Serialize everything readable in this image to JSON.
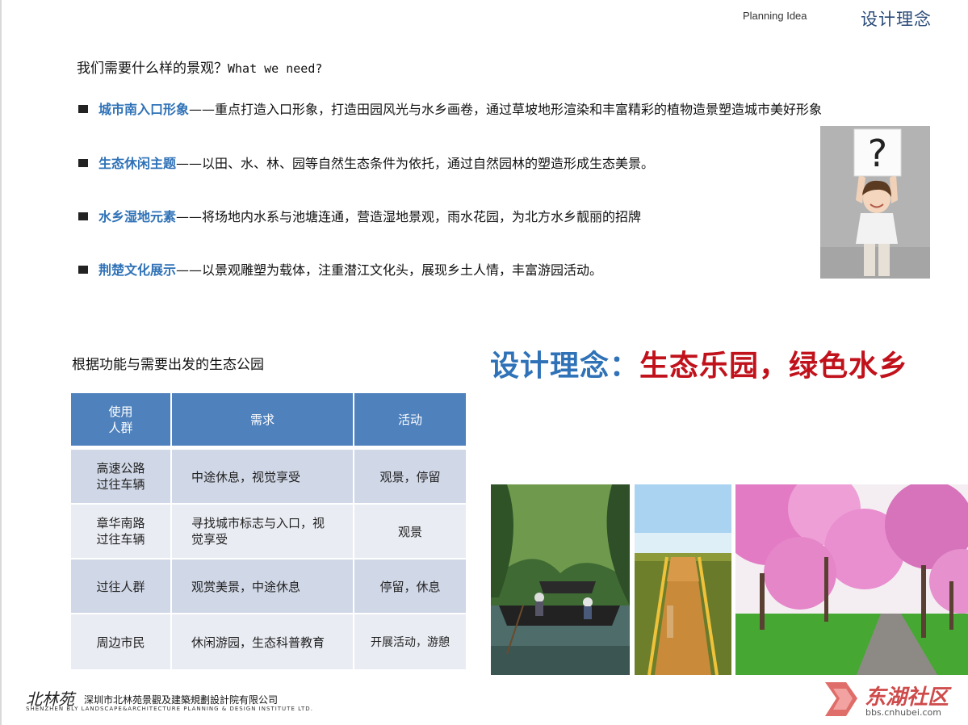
{
  "header": {
    "planning_idea": "Planning Idea",
    "title": "设计理念"
  },
  "question": {
    "cn": "我们需要什么样的景观？",
    "en": "What we need?"
  },
  "bullets": [
    {
      "keyword": "城市南入口形象",
      "text": "——重点打造入口形象，打造田园风光与水乡画卷，通过草坡地形渲染和丰富精彩的植物造景塑造城市美好形象"
    },
    {
      "keyword": "生态休闲主题",
      "text": "——以田、水、林、园等自然生态条件为依托，通过自然园林的塑造形成生态美景。"
    },
    {
      "keyword": "水乡湿地元素",
      "text": "——将场地内水系与池塘连通，营造湿地景观，雨水花园，为北方水乡靓丽的招牌"
    },
    {
      "keyword": "荆楚文化展示",
      "text": "——以景观雕塑为载体，注重潜江文化头，展现乡土人情，丰富游园活动。"
    }
  ],
  "child_photo": {
    "sign_text": "?"
  },
  "table": {
    "title": "根据功能与需要出发的生态公园",
    "headers": [
      "使用\n人群",
      "需求",
      "活动"
    ],
    "rows": [
      [
        "高速公路\n过往车辆",
        "中途休息，视觉享受",
        "观景，停留"
      ],
      [
        "章华南路\n过往车辆",
        "寻找城市标志与入口，视\n觉享受",
        "观景"
      ],
      [
        "过往人群",
        "观赏美景，中途休息",
        "停留，休息"
      ],
      [
        "周边市民",
        "休闲游园，生态科普教育",
        "开展活动，游憩"
      ]
    ]
  },
  "slogan": {
    "prefix": "设计理念：",
    "highlight": "生态乐园，绿色水乡"
  },
  "footer": {
    "logo_script": "北林苑",
    "company_cn": "深圳市北林苑景觀及建築規劃設計院有限公司",
    "company_en": "SHENZHEN BLY LANDSCAPE&ARCHITECTURE PLANNING & DESIGN INSTITUTE LTD."
  },
  "watermark": {
    "name": "东湖社区",
    "url": "bbs.cnhubei.com"
  },
  "colors": {
    "accent_blue": "#2f72b7",
    "slogan_red": "#c1121c",
    "table_header": "#4f81bd"
  }
}
